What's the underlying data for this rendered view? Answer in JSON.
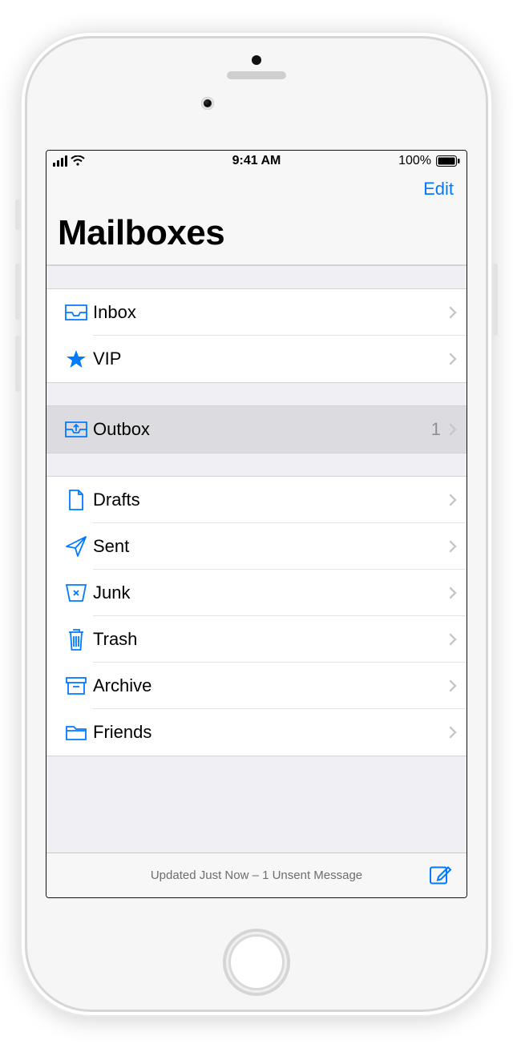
{
  "statusbar": {
    "time": "9:41 AM",
    "battery_pct": "100%"
  },
  "nav": {
    "edit_label": "Edit",
    "title": "Mailboxes"
  },
  "group1": [
    {
      "icon": "inbox-icon",
      "label": "Inbox"
    },
    {
      "icon": "star-icon",
      "label": "VIP"
    }
  ],
  "group2": [
    {
      "icon": "outbox-icon",
      "label": "Outbox",
      "count": "1",
      "selected": true
    }
  ],
  "group3": [
    {
      "icon": "drafts-icon",
      "label": "Drafts"
    },
    {
      "icon": "sent-icon",
      "label": "Sent"
    },
    {
      "icon": "junk-icon",
      "label": "Junk"
    },
    {
      "icon": "trash-icon",
      "label": "Trash"
    },
    {
      "icon": "archive-icon",
      "label": "Archive"
    },
    {
      "icon": "folder-icon",
      "label": "Friends"
    }
  ],
  "toolbar": {
    "status_text": "Updated Just Now – 1 Unsent Message"
  },
  "colors": {
    "accent": "#007aff"
  }
}
